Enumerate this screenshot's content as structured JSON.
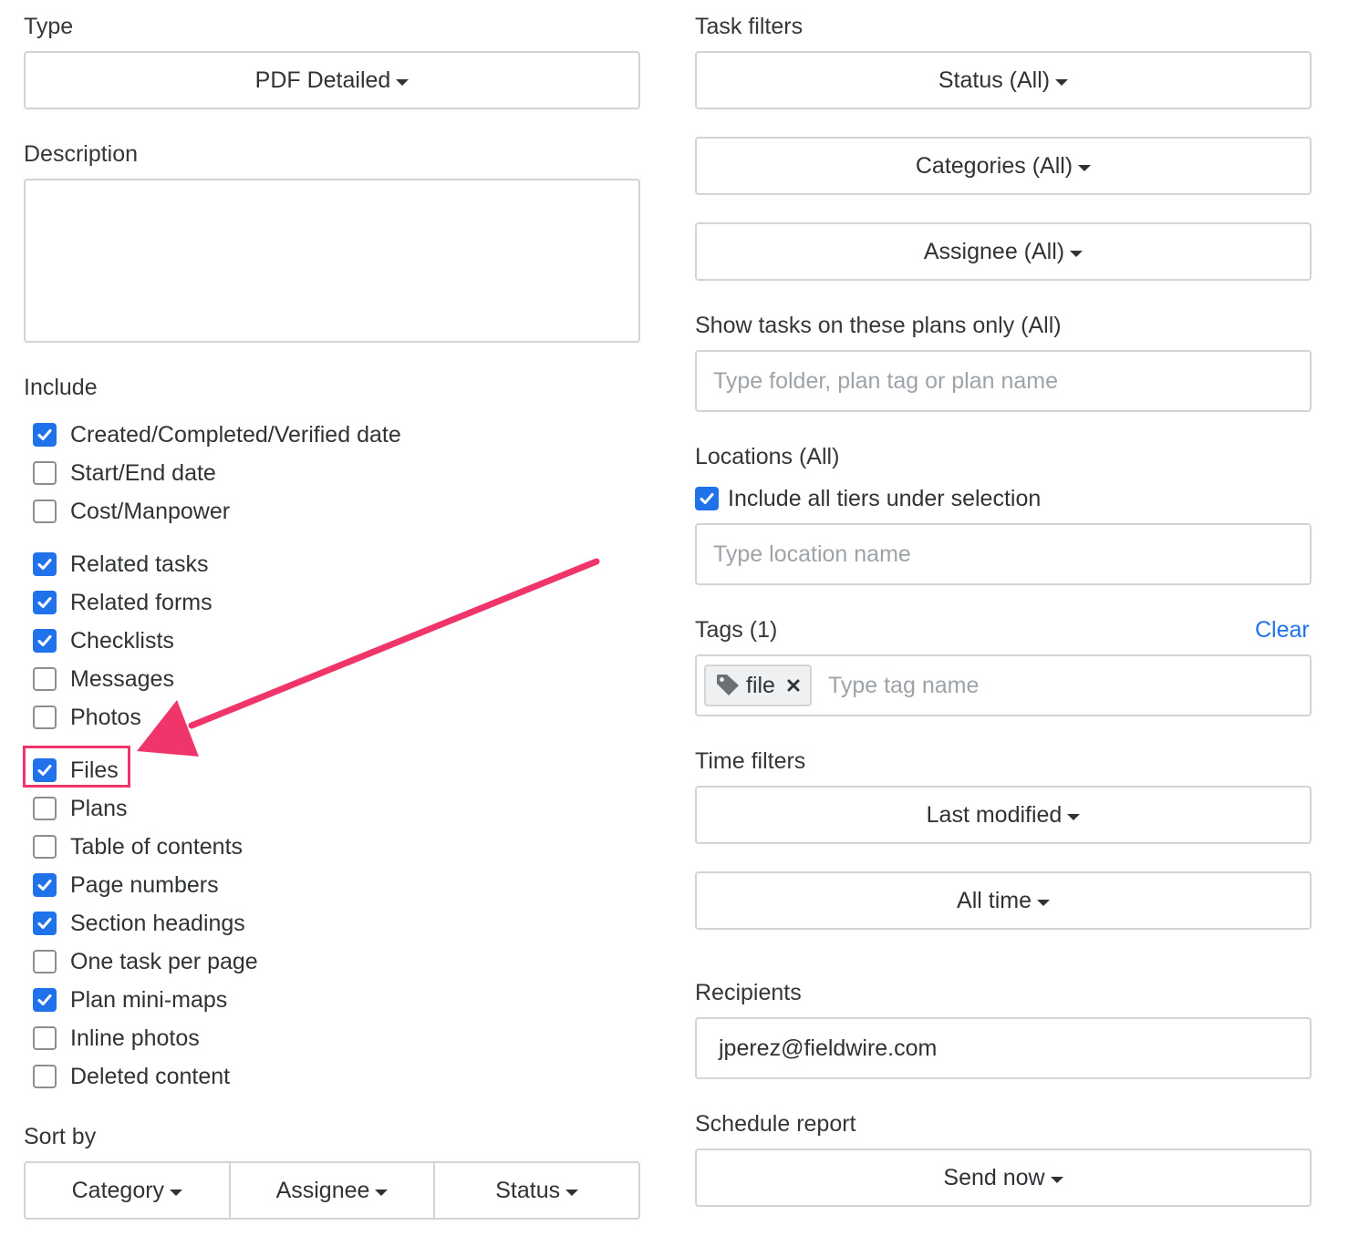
{
  "left": {
    "type_label": "Type",
    "type_value": "PDF Detailed",
    "description_label": "Description",
    "description_value": "",
    "include_label": "Include",
    "include_items": [
      {
        "label": "Created/Completed/Verified date",
        "checked": true
      },
      {
        "label": "Start/End date",
        "checked": false
      },
      {
        "label": "Cost/Manpower",
        "checked": false
      },
      {
        "label": "Related tasks",
        "checked": true
      },
      {
        "label": "Related forms",
        "checked": true
      },
      {
        "label": "Checklists",
        "checked": true
      },
      {
        "label": "Messages",
        "checked": false
      },
      {
        "label": "Photos",
        "checked": false
      },
      {
        "label": "Files",
        "checked": true
      },
      {
        "label": "Plans",
        "checked": false
      },
      {
        "label": "Table of contents",
        "checked": false
      },
      {
        "label": "Page numbers",
        "checked": true
      },
      {
        "label": "Section headings",
        "checked": true
      },
      {
        "label": "One task per page",
        "checked": false
      },
      {
        "label": "Plan mini-maps",
        "checked": true
      },
      {
        "label": "Inline photos",
        "checked": false
      },
      {
        "label": "Deleted content",
        "checked": false
      }
    ],
    "sort_label": "Sort by",
    "sort_buttons": [
      "Category",
      "Assignee",
      "Status"
    ]
  },
  "right": {
    "task_filters_label": "Task filters",
    "status_filter": "Status (All)",
    "categories_filter": "Categories (All)",
    "assignee_filter": "Assignee (All)",
    "plans_label": "Show tasks on these plans only (All)",
    "plans_placeholder": "Type folder, plan tag or plan name",
    "locations_label": "Locations (All)",
    "include_tiers_label": "Include all tiers under selection",
    "include_tiers_checked": true,
    "location_placeholder": "Type location name",
    "tags_label": "Tags (1)",
    "tags_clear": "Clear",
    "tag_chip": "file",
    "tag_placeholder": "Type tag name",
    "time_filters_label": "Time filters",
    "time_field": "Last modified",
    "time_range": "All time",
    "recipients_label": "Recipients",
    "recipients_value": "jperez@fieldwire.com",
    "schedule_label": "Schedule report",
    "schedule_value": "Send now"
  },
  "colors": {
    "accent": "#1f72ea",
    "annotation": "#f0356b",
    "border": "#d2d4d6"
  },
  "icons": {
    "dropdown": "caret-down-icon",
    "tag": "tag-icon",
    "remove": "close-icon",
    "check": "checkmark-icon"
  }
}
